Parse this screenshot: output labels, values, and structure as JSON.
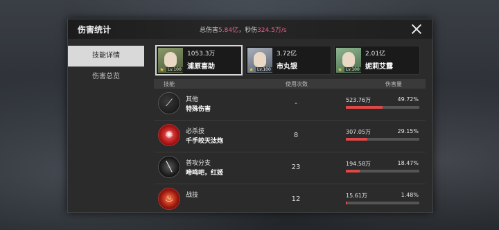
{
  "panel": {
    "title": "伤害统计",
    "total_label": "总伤害",
    "total_value": "5.84亿",
    "dps_label": "，秒伤",
    "dps_value": "324.5万/s"
  },
  "sidebar": {
    "items": [
      {
        "label": "技能详情",
        "active": true
      },
      {
        "label": "伤害总览",
        "active": false
      }
    ]
  },
  "heroes": [
    {
      "damage": "1053.3万",
      "name": "浦原喜助",
      "level": "Lv.100",
      "active": true
    },
    {
      "damage": "3.72亿",
      "name": "市丸银",
      "level": "Lv.100",
      "active": false
    },
    {
      "damage": "2.01亿",
      "name": "妮莉艾露",
      "level": "Lv.100",
      "active": false
    }
  ],
  "table": {
    "headers": {
      "skill": "技能",
      "uses": "使用次数",
      "damage": "伤害量"
    },
    "rows": [
      {
        "category": "其他",
        "name": "特殊伤害",
        "uses": "-",
        "amount": "523.76万",
        "percent": "49.72%",
        "fraction": 0.4972,
        "icon": "slash-icon"
      },
      {
        "category": "必杀技",
        "name": "千手皎天汰炮",
        "uses": "8",
        "amount": "307.05万",
        "percent": "29.15%",
        "fraction": 0.2915,
        "icon": "burst-icon"
      },
      {
        "category": "普攻分支",
        "name": "啼鸣吧，红姬",
        "uses": "23",
        "amount": "194.58万",
        "percent": "18.47%",
        "fraction": 0.1847,
        "icon": "sword-icon"
      },
      {
        "category": "战技",
        "name": "",
        "uses": "12",
        "amount": "15.61万",
        "percent": "1.48%",
        "fraction": 0.0148,
        "icon": "flame-icon"
      }
    ]
  },
  "colors": {
    "accent_pink": "#e8608a",
    "bar_red": "#e04848"
  }
}
